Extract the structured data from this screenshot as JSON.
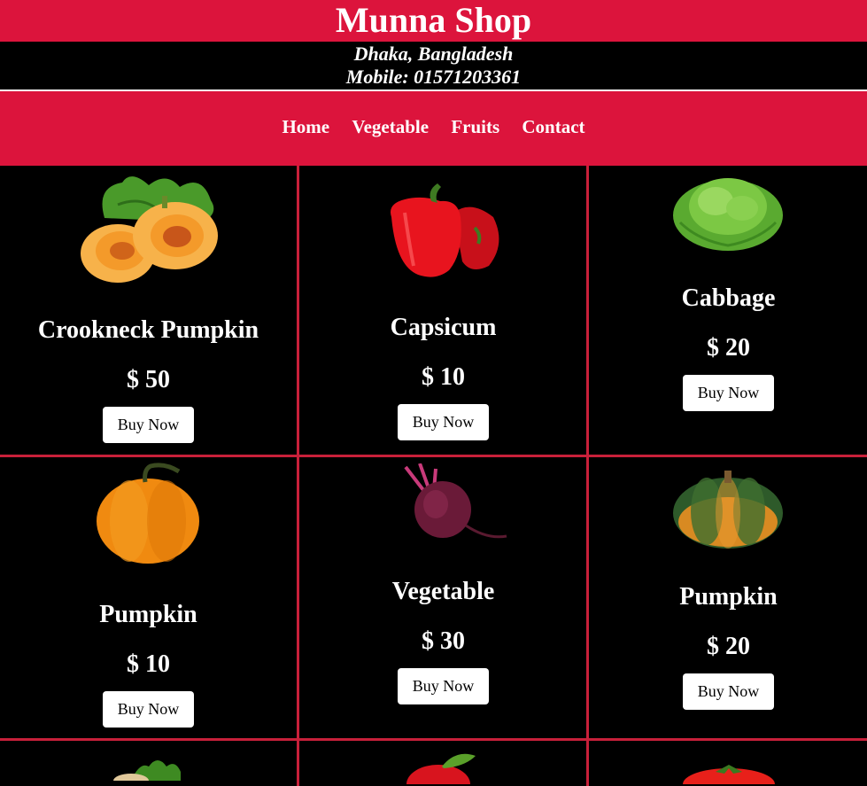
{
  "header": {
    "title": "Munna Shop",
    "location": "Dhaka, Bangladesh",
    "mobile": "Mobile: 01571203361"
  },
  "nav": {
    "items": [
      "Home",
      "Vegetable",
      "Fruits",
      "Contact"
    ]
  },
  "products": [
    {
      "name": "Crookneck Pumpkin",
      "price": "$ 50",
      "button": "Buy Now",
      "icon": "cut-pumpkin-image"
    },
    {
      "name": "Capsicum",
      "price": "$ 10",
      "button": "Buy Now",
      "icon": "red-capsicum-image"
    },
    {
      "name": "Cabbage",
      "price": "$ 20",
      "button": "Buy Now",
      "icon": "lettuce-image"
    },
    {
      "name": "Pumpkin",
      "price": "$ 10",
      "button": "Buy Now",
      "icon": "orange-pumpkin-image"
    },
    {
      "name": "Vegetable",
      "price": "$ 30",
      "button": "Buy Now",
      "icon": "beetroot-image"
    },
    {
      "name": "Pumpkin",
      "price": "$ 20",
      "button": "Buy Now",
      "icon": "green-pumpkin-image"
    }
  ],
  "colors": {
    "brand": "#dc143c",
    "background": "#000000",
    "grid_line": "#c8203a"
  }
}
